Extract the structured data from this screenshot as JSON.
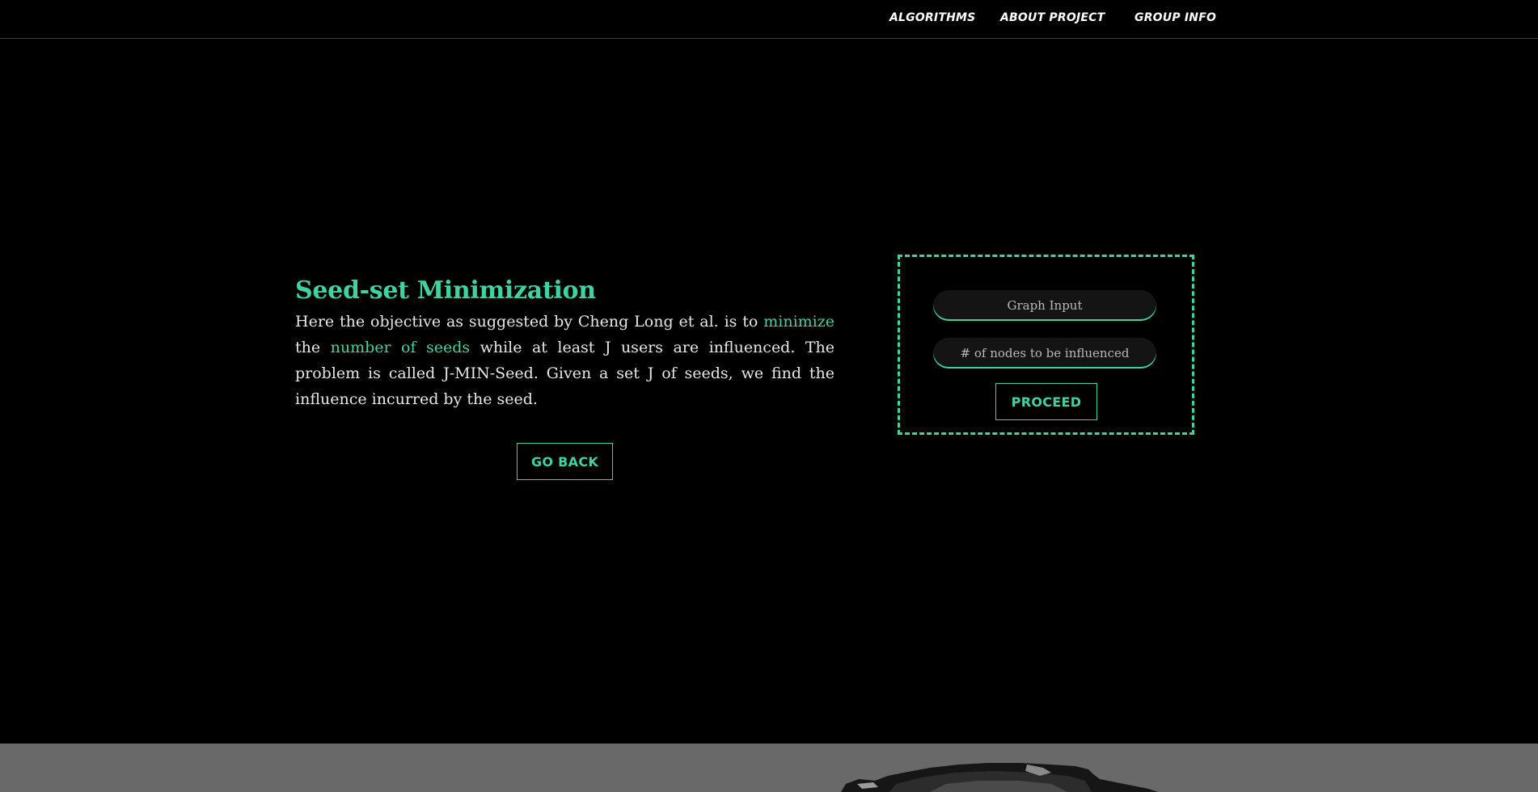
{
  "nav": {
    "items": [
      {
        "label": "ALGORITHMS"
      },
      {
        "label": "ABOUT PROJECT"
      },
      {
        "label": "GROUP INFO"
      }
    ]
  },
  "intro": {
    "title": "Seed-set Minimization",
    "desc_part1": "Here the objective as suggested by Cheng Long et al. is to ",
    "desc_highlight1": "minimize",
    "desc_part2": " the ",
    "desc_highlight2": "number of seeds",
    "desc_part3": " while at least J users are influenced. The problem is called J-MIN-Seed. Given a set J of seeds, we find the influence incurred by the seed.",
    "back_label": "GO BACK"
  },
  "form": {
    "graph_input_placeholder": "Graph Input",
    "nodes_input_placeholder": "# of nodes to be influenced",
    "proceed_label": "PROCEED"
  },
  "colors": {
    "accent": "#3ed3a2",
    "background": "#000000",
    "text": "#e6e6e6",
    "field_bg": "#141414",
    "footer_band": "#6a6a6a"
  },
  "icons": {
    "footer_image": "rocky-landscape-image"
  }
}
